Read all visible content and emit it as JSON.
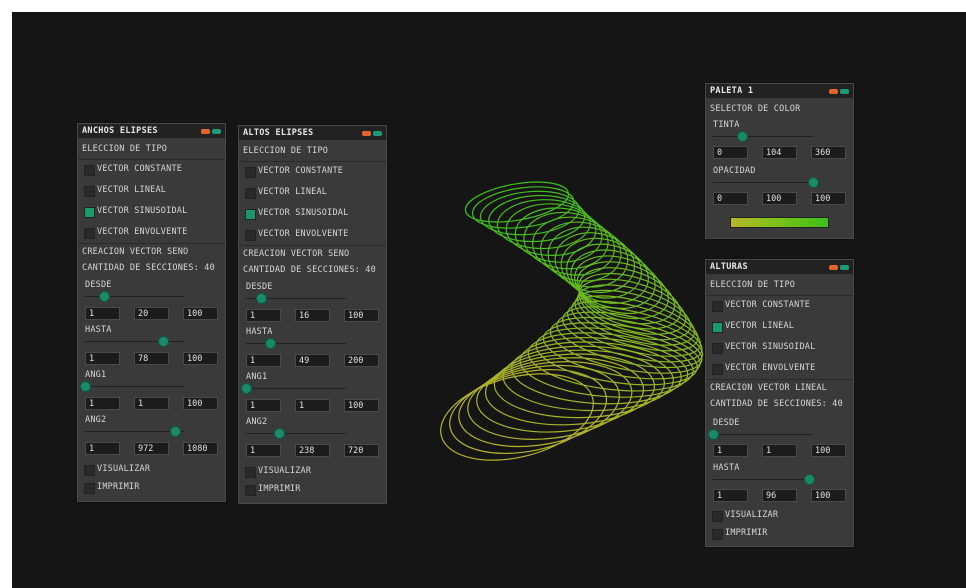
{
  "colors": {
    "background": "#151515",
    "panel": "#3a3a3a",
    "accent_green": "#1a9a6a",
    "close_orange": "#e8632a",
    "wireframe_top": "#3cc01a",
    "wireframe_bottom": "#b8b42a"
  },
  "panels": {
    "anchos": {
      "title": "ANCHOS ELIPSES",
      "eleccion": "ELECCION DE TIPO",
      "opts": [
        "VECTOR CONSTANTE",
        "VECTOR LINEAL",
        "VECTOR SINUSOIDAL",
        "VECTOR ENVOLVENTE"
      ],
      "selected_index": 2,
      "creacion": "CREACION VECTOR SENO",
      "cantidad": "CANTIDAD DE SECCIONES: 40",
      "sliders": [
        {
          "label": "DESDE",
          "min": "1",
          "value": "20",
          "max": "100",
          "fraction": 0.19
        },
        {
          "label": "HASTA",
          "min": "1",
          "value": "78",
          "max": "100",
          "fraction": 0.78
        },
        {
          "label": "ANG1",
          "min": "1",
          "value": "1",
          "max": "100",
          "fraction": 0.0
        },
        {
          "label": "ANG2",
          "min": "1",
          "value": "972",
          "max": "1080",
          "fraction": 0.9
        }
      ],
      "visualizar": "VISUALIZAR",
      "imprimir": "IMPRIMIR"
    },
    "altos": {
      "title": "ALTOS ELIPSES",
      "eleccion": "ELECCION DE TIPO",
      "opts": [
        "VECTOR CONSTANTE",
        "VECTOR LINEAL",
        "VECTOR SINUSOIDAL",
        "VECTOR ENVOLVENTE"
      ],
      "selected_index": 2,
      "creacion": "CREACION VECTOR SENO",
      "cantidad": "CANTIDAD DE SECCIONES: 40",
      "sliders": [
        {
          "label": "DESDE",
          "min": "1",
          "value": "16",
          "max": "100",
          "fraction": 0.15
        },
        {
          "label": "HASTA",
          "min": "1",
          "value": "49",
          "max": "200",
          "fraction": 0.24
        },
        {
          "label": "ANG1",
          "min": "1",
          "value": "1",
          "max": "100",
          "fraction": 0.0
        },
        {
          "label": "ANG2",
          "min": "1",
          "value": "238",
          "max": "720",
          "fraction": 0.33
        }
      ],
      "visualizar": "VISUALIZAR",
      "imprimir": "IMPRIMIR"
    },
    "paleta": {
      "title": "PALETA 1",
      "selector": "SELECTOR DE COLOR",
      "sliders": [
        {
          "label": "TINTA",
          "min": "0",
          "value": "104",
          "max": "360",
          "fraction": 0.29
        },
        {
          "label": "OPACIDAD",
          "min": "0",
          "value": "100",
          "max": "100",
          "fraction": 1.0
        }
      ],
      "preview_color": "#84c21a"
    },
    "alturas": {
      "title": "ALTURAS",
      "eleccion": "ELECCION DE TIPO",
      "opts": [
        "VECTOR CONSTANTE",
        "VECTOR LINEAL",
        "VECTOR SINUSOIDAL",
        "VECTOR ENVOLVENTE"
      ],
      "selected_index": 1,
      "creacion": "CREACION VECTOR LINEAL",
      "cantidad": "CANTIDAD DE SECCIONES: 40",
      "sliders": [
        {
          "label": "DESDE",
          "min": "1",
          "value": "1",
          "max": "100",
          "fraction": 0.0
        },
        {
          "label": "HASTA",
          "min": "1",
          "value": "96",
          "max": "100",
          "fraction": 0.96
        }
      ],
      "visualizar": "VISUALIZAR",
      "imprimir": "IMPRIMIR"
    }
  }
}
